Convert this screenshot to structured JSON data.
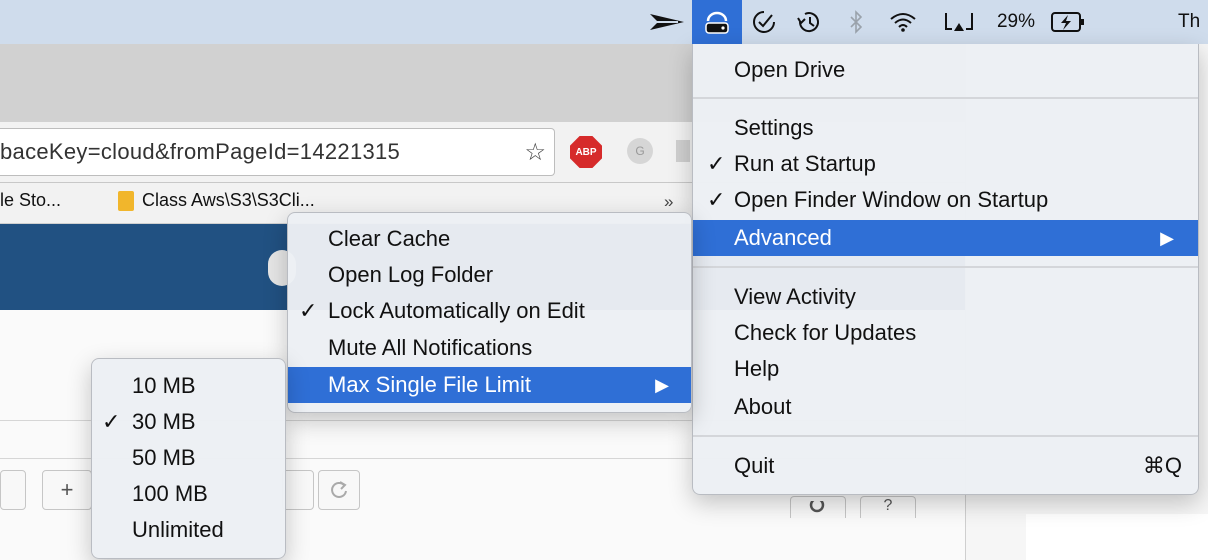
{
  "menubar": {
    "battery_percent": "29%",
    "clock_partial": "Th"
  },
  "browser": {
    "url_text": "baceKey=cloud&fromPageId=14221315",
    "adblock_label": "ABP",
    "ext_label": "G",
    "bookmarks": [
      {
        "label": "le Sto..."
      },
      {
        "label": "Class Aws\\S3\\S3Cli..."
      }
    ],
    "bookmarks_overflow": "»",
    "toolbar_buttons": [
      "+",
      "?"
    ]
  },
  "main_menu": {
    "items": [
      {
        "label": "Open Drive",
        "checked": false
      },
      {
        "label": "Settings",
        "checked": false
      },
      {
        "label": "Run at Startup",
        "checked": true
      },
      {
        "label": "Open Finder Window on Startup",
        "checked": true
      },
      {
        "label": "Advanced",
        "checked": false,
        "submenu": true,
        "highlighted": true
      },
      {
        "label": "View Activity",
        "checked": false
      },
      {
        "label": "Check for Updates",
        "checked": false
      },
      {
        "label": "Help",
        "checked": false
      },
      {
        "label": "About",
        "checked": false
      },
      {
        "label": "Quit",
        "checked": false,
        "shortcut": "⌘Q"
      }
    ]
  },
  "advanced_menu": {
    "items": [
      {
        "label": "Clear Cache",
        "checked": false
      },
      {
        "label": "Open Log Folder",
        "checked": false
      },
      {
        "label": "Lock Automatically on Edit",
        "checked": true
      },
      {
        "label": "Mute All Notifications",
        "checked": false
      },
      {
        "label": "Max Single File Limit",
        "checked": false,
        "submenu": true,
        "highlighted": true
      }
    ]
  },
  "limit_menu": {
    "items": [
      {
        "label": "10 MB",
        "checked": false
      },
      {
        "label": "30 MB",
        "checked": true
      },
      {
        "label": "50 MB",
        "checked": false
      },
      {
        "label": "100 MB",
        "checked": false
      },
      {
        "label": "Unlimited",
        "checked": false
      }
    ]
  },
  "glyphs": {
    "check": "✓",
    "submenu_arrow": "▶",
    "star": "☆"
  },
  "colors": {
    "menubar_bg": "#cfdcec",
    "highlight": "#2f6fd6",
    "app_header": "#215182"
  }
}
